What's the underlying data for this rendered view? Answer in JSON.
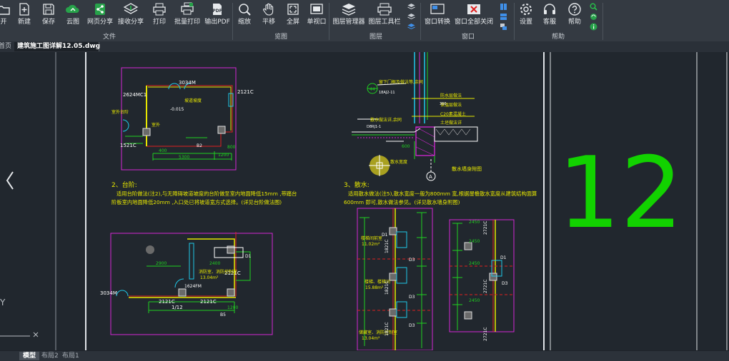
{
  "toolbar": {
    "buttons": [
      {
        "id": "open",
        "label": "开"
      },
      {
        "id": "new",
        "label": "新建"
      },
      {
        "id": "save",
        "label": "保存"
      },
      {
        "id": "cloud",
        "label": "云图"
      },
      {
        "id": "web_share",
        "label": "网页分享"
      },
      {
        "id": "receive_share",
        "label": "接收分享"
      },
      {
        "id": "print",
        "label": "打印"
      },
      {
        "id": "batch_print",
        "label": "批量打印"
      },
      {
        "id": "export_pdf",
        "label": "输出PDF"
      },
      {
        "id": "zoom",
        "label": "缩放"
      },
      {
        "id": "pan",
        "label": "平移"
      },
      {
        "id": "fullscreen",
        "label": "全屏"
      },
      {
        "id": "single_view",
        "label": "单视口"
      },
      {
        "id": "layer_manager",
        "label": "图层管理器"
      },
      {
        "id": "layer_toolbar",
        "label": "图层工具栏"
      },
      {
        "id": "window_switch",
        "label": "窗口转换"
      },
      {
        "id": "window_close_all",
        "label": "窗口全部关闭"
      },
      {
        "id": "settings",
        "label": "设置"
      },
      {
        "id": "support",
        "label": "客服"
      },
      {
        "id": "help",
        "label": "帮助"
      }
    ],
    "groups": {
      "file": "文件",
      "view": "览图",
      "layers": "图层",
      "window": "窗口",
      "help": "帮助"
    },
    "pdf_badge": "PDF"
  },
  "tabs": [
    {
      "label": "首页"
    },
    {
      "label": "建筑施工图详解12.05.dwg",
      "active": true
    }
  ],
  "layout_tabs": [
    {
      "label": "模型",
      "active": true
    },
    {
      "label": "布局2"
    },
    {
      "label": "布局1"
    }
  ],
  "drawing": {
    "sheet_number": "12",
    "axis_label": "Y",
    "notes": {
      "step_title": "2、台阶:",
      "step_line1": "适用台阶做法(注2),与无障碍坡道坡度的台阶做至室内地面降低15mm ,带踏台",
      "step_line2": "阶板室内地面降低20mm ,入口处已将坡道宽方式选择。(详见台阶做法图)",
      "drain_title": "3、散水:",
      "drain_line1": "适用散水做法(注5),散水宽度一般为800mm 宽,根据屋檐散水宽度从建筑结构面算",
      "drain_line2": "600mm 即可,散水做法参见。(详见散水墙身附图)",
      "drain_caption": "散水墙身附图"
    },
    "labels": {
      "p1_door": "3034M",
      "p1_win1": "2624MC1",
      "p1_win2": "2121C",
      "p1_win3": "1521C",
      "p1_elev": "-0.015",
      "p1_dim1": "5300",
      "p1_dim2": "1200",
      "p1_dim3": "800",
      "p1_dim4": "400",
      "p1_t1": "室外台阶",
      "p1_t2": "坡道坡度",
      "p1_t3": "室外",
      "p1_tag": "B2",
      "p2_win1": "3034M",
      "p2_win2": "2121C",
      "p2_win3": "2121C",
      "p2_win4": "2121C",
      "p2_win5": "1624FM",
      "p2_dim1": "2900",
      "p2_dim2": "2400",
      "p2_dim3": "1/12",
      "p2_dim4": "1200",
      "p2_t1": "消防室、消防控制室",
      "p2_t2": "13.04m²",
      "p2_tag1": "B5",
      "p2_tag2": "D1",
      "sec_t1": "留下门框及做法等,余同",
      "sec_t2": "防水层做法",
      "sec_t3": "保温层做法",
      "sec_t4": "散水做法详,余同",
      "sec_t5": "C20素混凝土",
      "sec_t6": "散水宽度",
      "sec_t7": "土坯做法详",
      "sec_ref1": "44",
      "sec_ref2": "18AJ2-11",
      "sec_ref3": "D8RJ1-1",
      "sec_ref4": "360",
      "sec_axis": "A",
      "sec_dim": "600",
      "e1_t1": "楼梯间前室",
      "e1_t2": "11.02m²",
      "e1_t3": "楼梯、楼梯间",
      "e1_t4": "15.88m²",
      "e1_t5": "储藏室、消防控制室",
      "e1_t6": "13.04m²",
      "e1_w1": "1821C",
      "e1_w2": "1821C",
      "e1_w3": "1821C",
      "e1_d1": "D1",
      "e1_d2": "D3",
      "e1_d3": "D3",
      "e1_d4": "D3",
      "e2_w1": "2721C",
      "e2_w2": "2721C",
      "e2_w3": "2721C",
      "e2_d1": "D1",
      "e2_d2": "D3",
      "e2_dim1": "2450",
      "e2_dim2": "2450",
      "e2_dim3": "2450",
      "e2_dim4": "2450"
    }
  },
  "colors": {
    "accent": "#12d200",
    "magenta": "#d427d4",
    "yellow": "#e8e800",
    "cyan": "#20c8e8",
    "red": "#e02020",
    "green": "#20d020",
    "white": "#ffffff",
    "toolbar": "#343a42",
    "canvas": "#21272e"
  }
}
